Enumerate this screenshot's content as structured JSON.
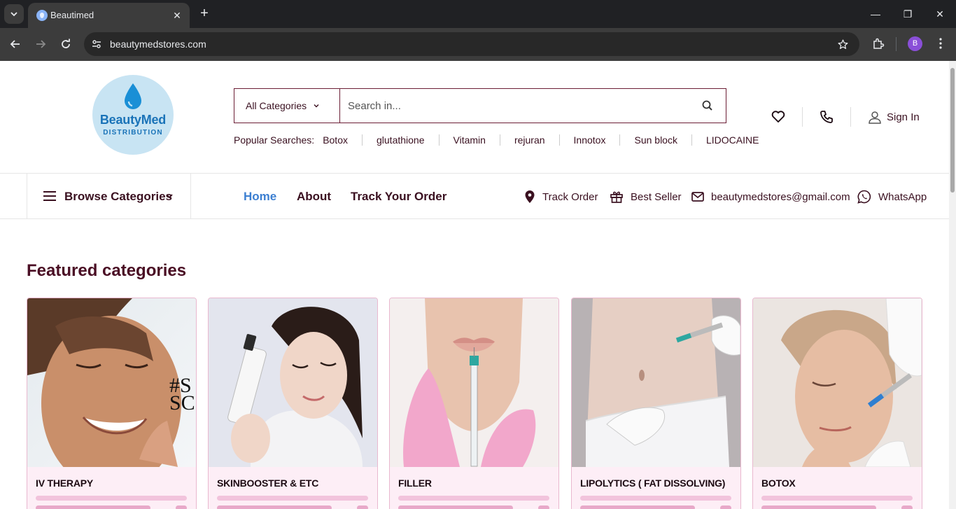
{
  "browser": {
    "tab_title": "Beautimed",
    "url": "beautymedstores.com",
    "profile_initial": "B"
  },
  "header": {
    "logo_line1": "BeautyMed",
    "logo_line2": "DISTRIBUTION",
    "search": {
      "category": "All Categories",
      "placeholder": "Search in..."
    },
    "popular_label": "Popular Searches:",
    "popular": [
      "Botox",
      "glutathione",
      "Vitamin",
      "rejuran",
      "Innotox",
      "Sun block",
      "LIDOCAINE"
    ],
    "signin": "Sign In"
  },
  "nav": {
    "browse": "Browse Categories",
    "links": [
      "Home",
      "About",
      "Track Your Order"
    ],
    "utilities": {
      "track": "Track Order",
      "bestseller": "Best Seller",
      "email": "beautymedstores@gmail.com",
      "whatsapp": "WhatsApp"
    }
  },
  "featured": {
    "title": "Featured categories",
    "overlay_text": "#S SC",
    "cards": [
      "IV THERAPY",
      "SKINBOOSTER & ETC",
      "FILLER",
      "LIPOLYTICS ( FAT DISSOLVING)",
      "BOTOX"
    ]
  },
  "colors": {
    "brand": "#4a0e24",
    "accent_blue": "#3c7fd1",
    "card_bg": "#fdeef6"
  }
}
